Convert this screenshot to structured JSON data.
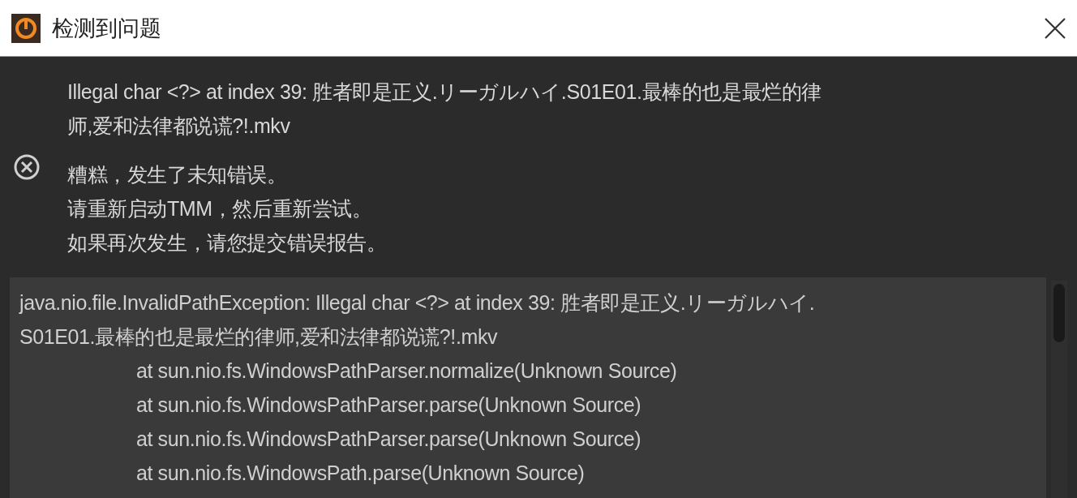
{
  "window": {
    "title": "检测到问题"
  },
  "message": {
    "lines": [
      "Illegal char <?> at index 39: 胜者即是正义.リーガルハイ.S01E01.最棒的也是最烂的律",
      "师,爱和法律都说谎?!.mkv"
    ]
  },
  "advice": [
    "糟糕，发生了未知错误。",
    "请重新启动TMM，然后重新尝试。",
    "如果再次发生，请您提交错误报告。"
  ],
  "stack_trace": [
    {
      "kind": "head",
      "text": "java.nio.file.InvalidPathException: Illegal char <?> at index 39: 胜者即是正义.リーガルハイ."
    },
    {
      "kind": "head",
      "text": "S01E01.最棒的也是最烂的律师,爱和法律都说谎?!.mkv"
    },
    {
      "kind": "frame",
      "text": "at sun.nio.fs.WindowsPathParser.normalize(Unknown Source)"
    },
    {
      "kind": "frame",
      "text": "at sun.nio.fs.WindowsPathParser.parse(Unknown Source)"
    },
    {
      "kind": "frame",
      "text": "at sun.nio.fs.WindowsPathParser.parse(Unknown Source)"
    },
    {
      "kind": "frame",
      "text": "at sun.nio.fs.WindowsPath.parse(Unknown Source)"
    }
  ]
}
